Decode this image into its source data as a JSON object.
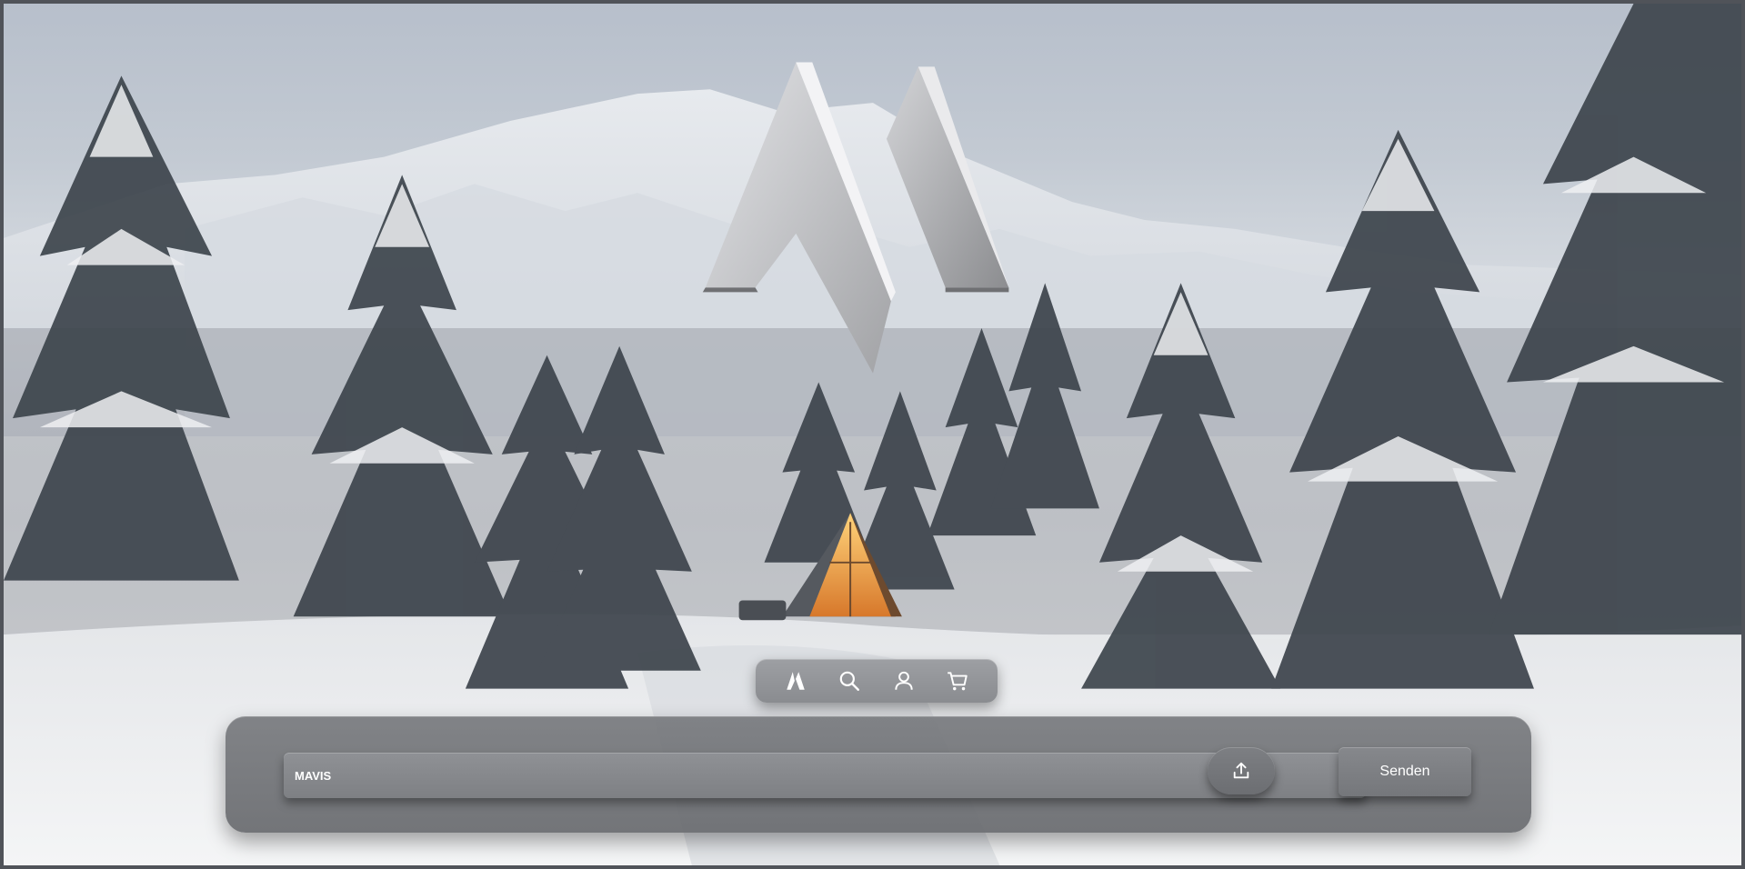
{
  "brand": {
    "logo_icon": "mountain-m-logo",
    "logo_colors": [
      "#d4d5d8",
      "#a9aaad",
      "#8d8e91"
    ]
  },
  "background": {
    "description_icon": "snowy-forest-cabin-scene",
    "sky_color": "#c3cad3",
    "cabin_glow": "#f0a040"
  },
  "nav": {
    "items": [
      {
        "id": "home",
        "icon": "logo-icon"
      },
      {
        "id": "search",
        "icon": "search-icon"
      },
      {
        "id": "account",
        "icon": "user-icon"
      },
      {
        "id": "cart",
        "icon": "cart-icon"
      }
    ]
  },
  "chat": {
    "input_value": "MAVIS",
    "upload_icon": "upload-icon",
    "send_label": "Senden"
  }
}
